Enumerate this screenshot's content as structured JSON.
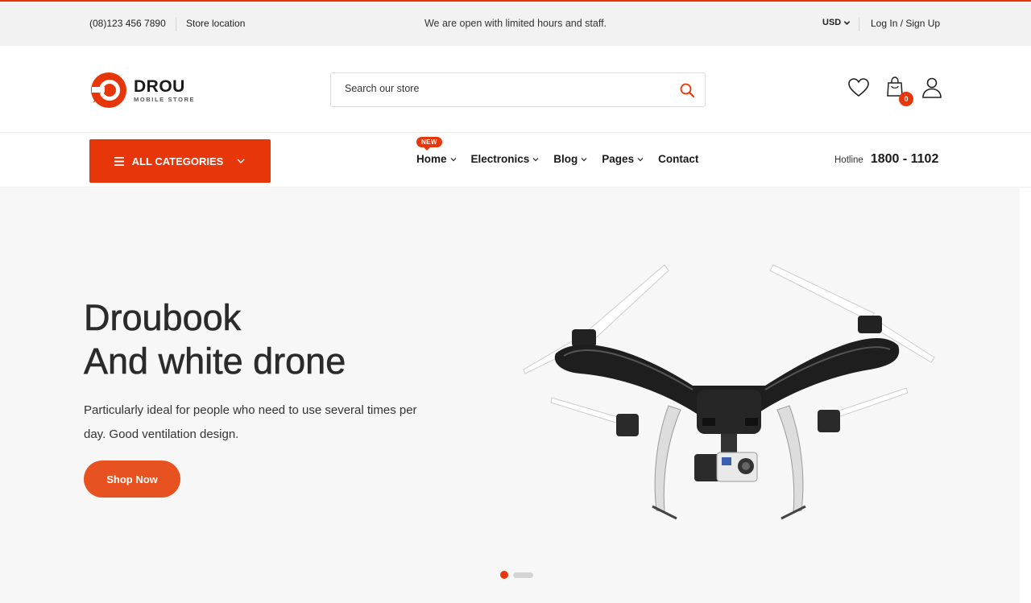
{
  "topbar": {
    "phone": "(08)123 456 7890",
    "store_location": "Store location",
    "message": "We are open with limited hours and staff.",
    "currency": "USD",
    "login": "Log In / Sign Up"
  },
  "header": {
    "logo_name": "DROU",
    "logo_sub": "MOBILE STORE",
    "search_placeholder": "Search our store",
    "cart_count": "0"
  },
  "nav": {
    "all_categories": "ALL CATEGORIES",
    "new_badge": "NEW",
    "items": [
      {
        "label": "Home"
      },
      {
        "label": "Electronics"
      },
      {
        "label": "Blog"
      },
      {
        "label": "Pages"
      },
      {
        "label": "Contact"
      }
    ],
    "hotline_label": "Hotline",
    "hotline_number": "1800 - 1102"
  },
  "hero": {
    "title_line1": "Droubook",
    "title_line2": "And white drone",
    "description": "Particularly ideal for people who need to use several times per day. Good ventilation design.",
    "cta": "Shop Now",
    "slide_active": 1,
    "slide_count": 2
  },
  "colors": {
    "accent": "#e6360a",
    "cta": "#e85221",
    "hero_bg": "#f7f7f7"
  },
  "icons": [
    "chevron-down-icon",
    "search-icon",
    "heart-icon",
    "shopping-bag-icon",
    "user-icon",
    "menu-icon"
  ]
}
